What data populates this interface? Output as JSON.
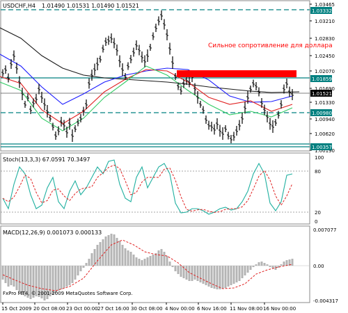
{
  "window": {
    "symbol_header": "USDCHF,H4",
    "ohlc": "1.01490 1.01531 1.01490 1.01521"
  },
  "annotation": {
    "text": "Сильное сопротивление для доллара",
    "color": "#ff0000",
    "zone_color": "#ff0000"
  },
  "price_axis": {
    "ticks": [
      "1.03465",
      "1.03210",
      "1.02830",
      "1.02450",
      "1.02070",
      "1.01690",
      "1.01330",
      "1.00940",
      "1.00620",
      "1.00190"
    ],
    "badges": [
      {
        "label": "1.03332",
        "kind": "level"
      },
      {
        "label": "1.01859",
        "kind": "level"
      },
      {
        "label": "1.01521",
        "kind": "bid"
      },
      {
        "label": "1.00980",
        "kind": "level"
      },
      {
        "label": "1.00357",
        "kind": "level"
      }
    ]
  },
  "stoch_panel": {
    "label": "Stoch(13,3,3) 67.0591 70.3497",
    "ticks": [
      "100",
      "80",
      "20",
      "0"
    ]
  },
  "macd_panel": {
    "label": "MACD(12,26,9) 0.001073 0.000133",
    "ticks": [
      "0.007077",
      "0.00",
      "-0.004317"
    ]
  },
  "time_axis": {
    "labels": [
      "15 Oct 2009",
      "20 Oct 08:00",
      "23 Oct 00:00",
      "27 Oct 16:00",
      "30 Oct 08:00",
      "4 Nov 00:00",
      "6 Nov 16:00",
      "11 Nov 08:00",
      "16 Nov 00:00"
    ]
  },
  "copyright": "FxPro MT4, © 2001-2009 MetaQuotes Software Corp.",
  "colors": {
    "level_line": "#008080",
    "price_line": "#000000",
    "ma_black": "#1a1a1a",
    "ma_blue": "#1a1aff",
    "ma_red": "#e02020",
    "ma_green": "#33cc66",
    "stoch_main": "#20b0a0",
    "stoch_signal": "#e02020",
    "macd_hist": "#b4b4b4",
    "macd_signal": "#e02020"
  }
}
